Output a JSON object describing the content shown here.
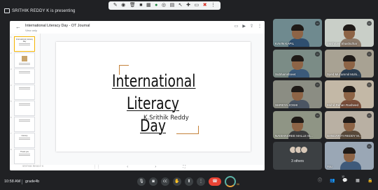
{
  "extension_toolbar": {
    "icons": [
      "pen-icon",
      "eye-icon",
      "trash-icon",
      "square-icon",
      "grid-icon",
      "palette-icon",
      "ring-icon",
      "chart-icon",
      "arrow-icon",
      "plus-icon",
      "doc-icon",
      "close-icon",
      "dots-icon"
    ],
    "glyphs": [
      "✎",
      "◉",
      "🗑",
      "■",
      "▦",
      "●",
      "◎",
      "▤",
      "↖",
      "✚",
      "▭",
      "✖",
      "⋮"
    ]
  },
  "presenter": {
    "text": "SRITHIK REDDY K is presenting"
  },
  "shared_window": {
    "doc_title": "International Literacy Day - OT Journal",
    "doc_subtitle": "View only",
    "header_icons": [
      "cast-icon",
      "play-icon",
      "share-icon",
      "more-icon"
    ],
    "header_glyphs": [
      "▭",
      "▶",
      "⇪",
      "⋮"
    ],
    "footer_note": "SRITHIK REDDY K",
    "footer_nav": [
      "⋮⋮",
      "‹",
      "›",
      "⛶"
    ],
    "thumbnails": [
      {
        "num": "1",
        "label": "International Literacy Day"
      },
      {
        "num": "2",
        "label": ""
      },
      {
        "num": "3",
        "label": ""
      },
      {
        "num": "4",
        "label": ""
      },
      {
        "num": "5",
        "label": ""
      },
      {
        "num": "6",
        "label": ""
      },
      {
        "num": "7",
        "label": "Literacy"
      },
      {
        "num": "8",
        "label": "Thank you"
      }
    ]
  },
  "slide": {
    "title_line1": "International",
    "title_line2": "Literacy Day",
    "author": "K.Srithik Reddy",
    "accent_color": "#c4823a"
  },
  "participants": [
    {
      "name": "KAVIN KAPIL",
      "bg": "#6f8a8f",
      "body": "#2f4f6f"
    },
    {
      "name": "Vaishnavi Shashidhar",
      "bg": "#c9cfc8",
      "body": "#8c7a6a"
    },
    {
      "name": "Subhamshreet",
      "bg": "#7b8c86",
      "body": "#3b5a7a"
    },
    {
      "name": "Syed Muzammil Mohi...",
      "bg": "#a8a293",
      "body": "#2c3e50"
    },
    {
      "name": "SHREYA JOSHI",
      "bg": "#8b8d83",
      "body": "#4b5563"
    },
    {
      "name": "Mohd Rehan Rasheed",
      "bg": "#c3b8a6",
      "body": "#7a4e3a"
    },
    {
      "name": "NAISHASREE MALLE M...",
      "bg": "#8f9585",
      "body": "#3d3d3d"
    },
    {
      "name": "SANDARITI REDDY M...",
      "bg": "#b9b0a3",
      "body": "#5a4a3a"
    }
  ],
  "others": {
    "label": "3 others"
  },
  "self_tile": {
    "name": "You",
    "bg": "#9aa7b5",
    "body": "#3f5a7a"
  },
  "bottom_bar": {
    "time": "10:58 AM",
    "meeting_code": "grade4b",
    "controls": [
      {
        "name": "mic-icon",
        "glyph": "🎙"
      },
      {
        "name": "camera-icon",
        "glyph": "◙"
      },
      {
        "name": "captions-icon",
        "glyph": "㏄"
      },
      {
        "name": "raise-hand-icon",
        "glyph": "✋"
      },
      {
        "name": "present-icon",
        "glyph": "⬆"
      },
      {
        "name": "more-options-icon",
        "glyph": "⋮"
      }
    ],
    "hangup_glyph": "☎",
    "wait_badge": "56",
    "people_count": "12",
    "right_icons": [
      {
        "name": "info-icon",
        "glyph": "ⓘ"
      },
      {
        "name": "people-icon",
        "glyph": "👥"
      },
      {
        "name": "chat-icon",
        "glyph": "💬"
      },
      {
        "name": "activities-icon",
        "glyph": "▦"
      },
      {
        "name": "lock-icon",
        "glyph": "🔒"
      }
    ]
  }
}
